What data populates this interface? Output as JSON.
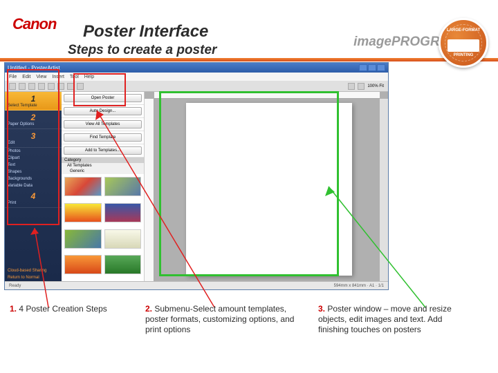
{
  "header": {
    "brand": "Canon",
    "title": "Poster Interface",
    "subtitle": "Steps to create a poster",
    "product": "imagePROGRAF",
    "tm": "™",
    "badge_top": "LARGE-FORMAT",
    "badge_bottom": "PRINTING"
  },
  "window": {
    "title": "Untitled - PosterArtist",
    "menu": [
      "File",
      "Edit",
      "View",
      "Insert",
      "Tool",
      "Help"
    ],
    "zoom": "100% Fit",
    "status_left": "Ready",
    "status_right": "594mm x 841mm · A1 · 1/1"
  },
  "left_steps": [
    {
      "num": "1",
      "label": "Select Template",
      "active": true
    },
    {
      "num": "2",
      "label": "Paper Options",
      "active": false
    },
    {
      "num": "3",
      "label": "Edit",
      "active": false
    }
  ],
  "left_subs": [
    "Photos",
    "Clipart",
    "Text",
    "Shapes",
    "Backgrounds",
    "Variable Data"
  ],
  "left_step4": {
    "num": "4",
    "label": "Print"
  },
  "left_bottom": [
    "Cloud-based Sharing",
    "Return to Normal"
  ],
  "middle_buttons": [
    "Open Poster",
    "Auto Design...",
    "View All Templates",
    "Find Template",
    "Add to Templates..."
  ],
  "category": {
    "label": "Category",
    "sub1": "All Templates",
    "sub2": "Generic"
  },
  "callouts": {
    "c1": {
      "num": "1.",
      "text": " 4 Poster Creation Steps"
    },
    "c2": {
      "num": "2.",
      "text": " Submenu-Select amount templates, poster formats, customizing options, and print options"
    },
    "c3": {
      "num": "3.",
      "text": " Poster window – move and resize objects, edit images and text.  Add finishing touches on posters"
    }
  }
}
